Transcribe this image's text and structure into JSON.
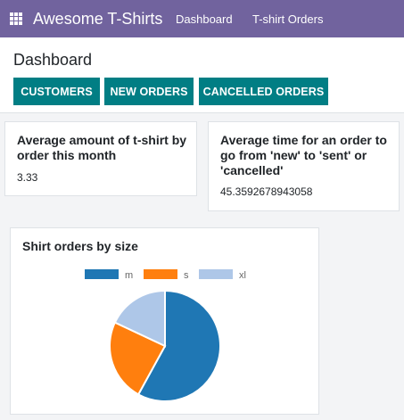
{
  "navbar": {
    "app_name": "Awesome T-Shirts",
    "links": [
      "Dashboard",
      "T-shirt Orders"
    ]
  },
  "control_panel": {
    "title": "Dashboard",
    "buttons": [
      "CUSTOMERS",
      "NEW ORDERS",
      "CANCELLED ORDERS"
    ]
  },
  "stats": [
    {
      "title_lines": [
        "Average amount of t-shirt by",
        "order this month"
      ],
      "value": "3.33"
    },
    {
      "title_lines": [
        "Average time for an order to",
        "go from 'new' to 'sent' or",
        "'cancelled'"
      ],
      "value": "45.3592678943058"
    }
  ],
  "colors": {
    "navbar": "#71639e",
    "button": "#017e84"
  },
  "chart_data": {
    "type": "pie",
    "title": "Shirt orders by size",
    "legend_position": "top",
    "categories": [
      "m",
      "s",
      "xl"
    ],
    "values": [
      58,
      24,
      18
    ],
    "colors": [
      "#1f77b4",
      "#ff7f0e",
      "#aec7e8"
    ]
  }
}
